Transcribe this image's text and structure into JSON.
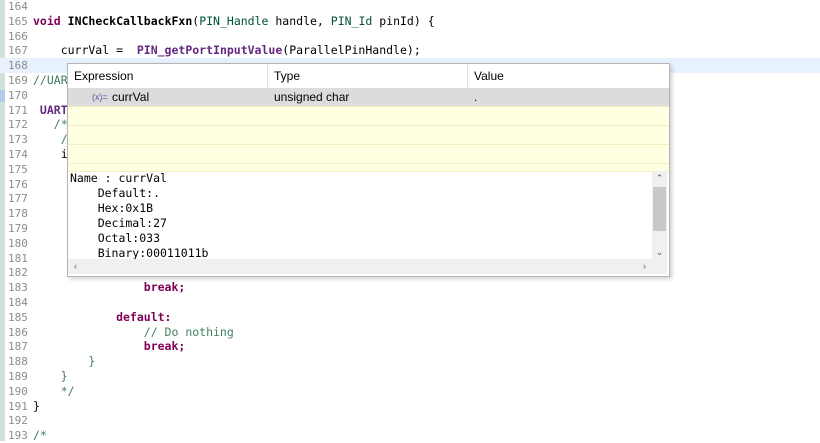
{
  "editor": {
    "lines": [
      {
        "n": "164",
        "segs": []
      },
      {
        "n": "165",
        "segs": [
          {
            "t": "void",
            "c": "kw"
          },
          {
            "t": " "
          },
          {
            "t": "INCheckCallbackFxn",
            "c": "fn"
          },
          {
            "t": "("
          },
          {
            "t": "PIN_Handle",
            "c": "ty"
          },
          {
            "t": " handle, "
          },
          {
            "t": "PIN_Id",
            "c": "ty"
          },
          {
            "t": " pinId) {"
          }
        ]
      },
      {
        "n": "166",
        "segs": []
      },
      {
        "n": "167",
        "segs": [
          {
            "t": "    currVal =  "
          },
          {
            "t": "PIN_getPortInputValue",
            "c": "tl"
          },
          {
            "t": "(ParallelPinHandle);"
          }
        ]
      },
      {
        "n": "168",
        "segs": [
          {
            "t": "    "
          }
        ],
        "hl": true
      },
      {
        "n": "169",
        "segs": [
          {
            "t": "//UART",
            "c": "cm"
          }
        ]
      },
      {
        "n": "170",
        "segs": []
      },
      {
        "n": "171",
        "segs": [
          {
            "t": " UART",
            "c": "tl"
          }
        ]
      },
      {
        "n": "172",
        "segs": [
          {
            "t": "   /*",
            "c": "cm"
          }
        ]
      },
      {
        "n": "173",
        "segs": [
          {
            "t": "    /",
            "c": "cm"
          }
        ]
      },
      {
        "n": "174",
        "segs": [
          {
            "t": "    i"
          }
        ]
      },
      {
        "n": "175",
        "segs": []
      },
      {
        "n": "176",
        "segs": []
      },
      {
        "n": "177",
        "segs": []
      },
      {
        "n": "178",
        "segs": []
      },
      {
        "n": "179",
        "segs": []
      },
      {
        "n": "180",
        "segs": []
      },
      {
        "n": "181",
        "segs": []
      },
      {
        "n": "182",
        "segs": []
      },
      {
        "n": "183",
        "segs": [
          {
            "t": "                break;",
            "c": "kw"
          }
        ]
      },
      {
        "n": "184",
        "segs": []
      },
      {
        "n": "185",
        "segs": [
          {
            "t": "            default:",
            "c": "kw"
          }
        ]
      },
      {
        "n": "186",
        "segs": [
          {
            "t": "                // Do nothing",
            "c": "cm"
          }
        ]
      },
      {
        "n": "187",
        "segs": [
          {
            "t": "                break;",
            "c": "kw"
          }
        ]
      },
      {
        "n": "188",
        "segs": [
          {
            "t": "        }",
            "c": "cm"
          }
        ]
      },
      {
        "n": "189",
        "segs": [
          {
            "t": "    }",
            "c": "cm"
          }
        ]
      },
      {
        "n": "190",
        "segs": [
          {
            "t": "    */",
            "c": "cm"
          }
        ]
      },
      {
        "n": "191",
        "segs": [
          {
            "t": "}"
          }
        ]
      },
      {
        "n": "192",
        "segs": []
      },
      {
        "n": "193",
        "segs": [
          {
            "t": "/*",
            "c": "cm"
          }
        ]
      }
    ]
  },
  "hover": {
    "columns": [
      "Expression",
      "Type",
      "Value"
    ],
    "rows": [
      {
        "icon": "(x)=",
        "expression": "currVal",
        "type": "unsigned char",
        "value": "."
      }
    ],
    "detail_lines": [
      "Name : currVal",
      "    Default:.",
      "    Hex:0x1B",
      "    Decimal:27",
      "    Octal:033",
      "    Binary:00011011b"
    ],
    "scroll_up": "⌃",
    "scroll_down": "⌄",
    "scroll_left": "‹",
    "scroll_right": "›"
  },
  "colors": {
    "keyword": "#7f0055",
    "comment": "#3f7f5f",
    "type": "#005032",
    "table_bg": "#ffffe1",
    "selected_row": "#dcdcdc",
    "current_line": "#e8f2fe"
  }
}
